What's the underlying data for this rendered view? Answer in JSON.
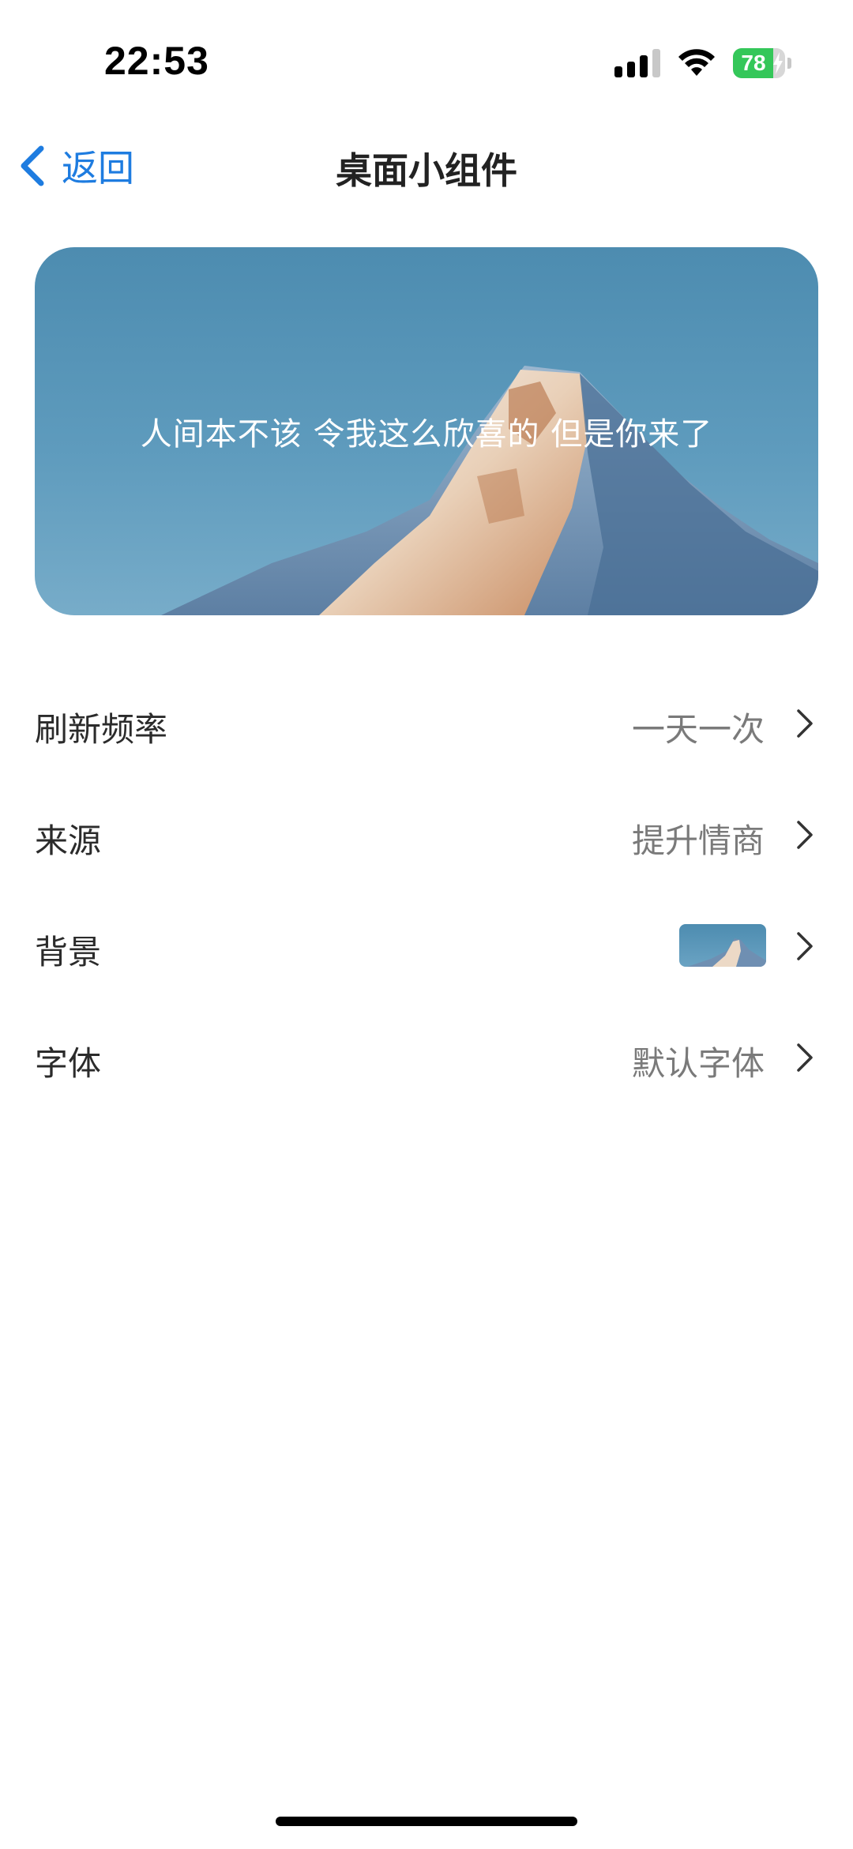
{
  "status_bar": {
    "time": "22:53",
    "battery": 78,
    "battery_color": "#34c759",
    "icons": [
      "signal-icon",
      "wifi-icon",
      "battery-icon"
    ]
  },
  "nav": {
    "back_label": "返回",
    "back_icon": "chevron-left-icon",
    "title": "桌面小组件",
    "accent_color": "#1e7ce0"
  },
  "preview": {
    "quote": "人间本不该 令我这么欣喜的 但是你来了"
  },
  "settings": [
    {
      "label": "刷新频率",
      "value": "一天一次"
    },
    {
      "label": "来源",
      "value": "提升情商"
    },
    {
      "label": "背景",
      "value": ""
    },
    {
      "label": "字体",
      "value": "默认字体"
    }
  ]
}
